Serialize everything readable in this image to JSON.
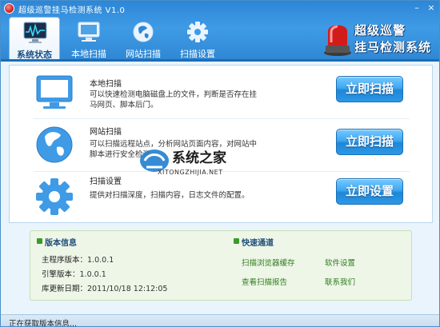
{
  "window": {
    "title": "超级巡警挂马检测系统 V1.0"
  },
  "tabs": [
    {
      "label": "系统状态",
      "icon": "monitor-chart-icon"
    },
    {
      "label": "本地扫描",
      "icon": "computer-icon"
    },
    {
      "label": "网站扫描",
      "icon": "globe-icon"
    },
    {
      "label": "扫描设置",
      "icon": "gear-icon"
    }
  ],
  "brand": {
    "line1": "超级巡警",
    "line2": "挂马检测系统"
  },
  "actions": [
    {
      "title": "本地扫描",
      "description": "可以快速检测电脑磁盘上的文件，判断是否存在挂马网页、脚本后门。",
      "button": "立即扫描",
      "icon": "computer-icon"
    },
    {
      "title": "网站扫描",
      "description": "可以扫描远程站点，分析网站页面内容，对网站中脚本进行安全检测。",
      "button": "立即扫描",
      "icon": "globe-icon"
    },
    {
      "title": "扫描设置",
      "description": "提供对扫描深度，扫描内容，日志文件的配置。",
      "button": "立即设置",
      "icon": "gear-icon"
    }
  ],
  "watermark": {
    "text": "系统之家",
    "url": "XITONGZHIJIA.NET"
  },
  "version_info": {
    "heading": "版本信息",
    "rows": [
      {
        "label": "主程序版本：",
        "value": "1.0.0.1"
      },
      {
        "label": "引擎版本：",
        "value": "1.0.0.1"
      },
      {
        "label": "库更新日期：",
        "value": "2011/10/18 12:12:05"
      }
    ]
  },
  "quick_links": {
    "heading": "快速通道",
    "items": [
      "扫描浏览器缓存",
      "软件设置",
      "查看扫描报告",
      "联系我们"
    ]
  },
  "status": {
    "text": "正在获取版本信息..."
  },
  "colors": {
    "header_blue": "#2d86d6",
    "button_blue": "#2b98e6",
    "link_green": "#2f7d1c",
    "brand_red": "#c41717"
  }
}
